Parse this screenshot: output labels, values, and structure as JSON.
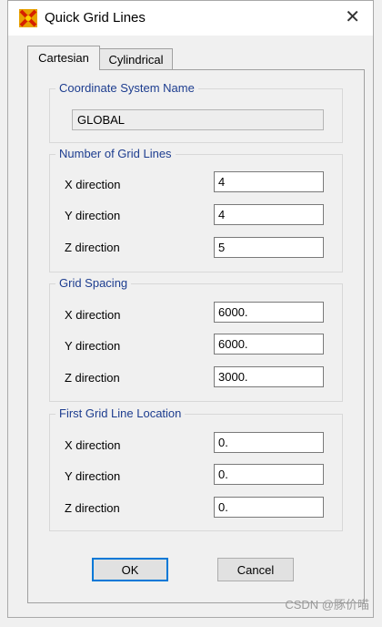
{
  "window": {
    "title": "Quick Grid Lines",
    "close_glyph": "✕"
  },
  "tabs": [
    {
      "label": "Cartesian",
      "active": true
    },
    {
      "label": "Cylindrical",
      "active": false
    }
  ],
  "coordinate_system": {
    "group_title": "Coordinate System Name",
    "value": "GLOBAL"
  },
  "number_of_grid_lines": {
    "group_title": "Number of Grid Lines",
    "rows": [
      {
        "label": "X direction",
        "value": "4"
      },
      {
        "label": "Y direction",
        "value": "4"
      },
      {
        "label": "Z direction",
        "value": "5"
      }
    ]
  },
  "grid_spacing": {
    "group_title": "Grid Spacing",
    "rows": [
      {
        "label": "X direction",
        "value": "6000."
      },
      {
        "label": "Y direction",
        "value": "6000."
      },
      {
        "label": "Z direction",
        "value": "3000."
      }
    ]
  },
  "first_grid_line_location": {
    "group_title": "First Grid Line Location",
    "rows": [
      {
        "label": "X direction",
        "value": "0."
      },
      {
        "label": "Y direction",
        "value": "0."
      },
      {
        "label": "Z direction",
        "value": "0."
      }
    ]
  },
  "buttons": {
    "ok": "OK",
    "cancel": "Cancel"
  },
  "watermark": "CSDN @豚价喵",
  "icons": {
    "app": "sap2000-icon",
    "close": "close-icon"
  },
  "colors": {
    "group_title": "#1d3d8f",
    "ok_border": "#0078d7"
  }
}
